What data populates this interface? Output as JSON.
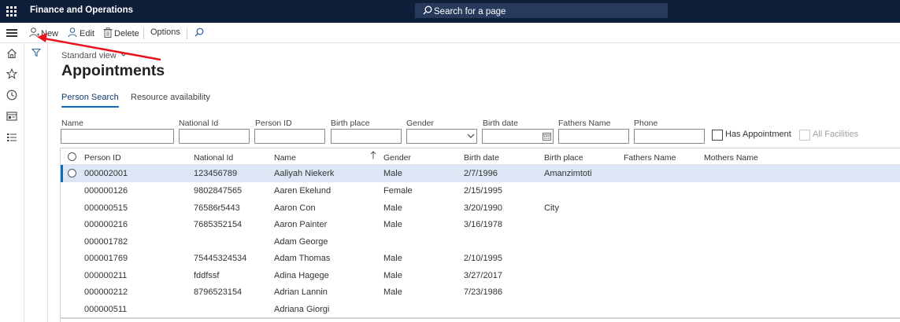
{
  "header": {
    "app_title": "Finance and Operations",
    "search_placeholder": "Search for a page"
  },
  "actions": {
    "new": "New",
    "edit": "Edit",
    "delete": "Delete",
    "options": "Options"
  },
  "page": {
    "view": "Standard view",
    "title": "Appointments"
  },
  "tabs": [
    {
      "label": "Person Search",
      "active": true
    },
    {
      "label": "Resource availability",
      "active": false
    }
  ],
  "filters": {
    "name_label": "Name",
    "national_id_label": "National Id",
    "person_id_label": "Person ID",
    "birth_place_label": "Birth place",
    "gender_label": "Gender",
    "birth_date_label": "Birth date",
    "fathers_name_label": "Fathers Name",
    "phone_label": "Phone",
    "has_appointment_label": "Has Appointment",
    "all_facilities_label": "All Facilities"
  },
  "grid": {
    "columns": [
      "Person ID",
      "National Id",
      "Name",
      "Gender",
      "Birth date",
      "Birth place",
      "Fathers Name",
      "Mothers Name"
    ],
    "rows": [
      {
        "person_id": "000002001",
        "national_id": "123456789",
        "name": "Aaliyah Niekerk",
        "gender": "Male",
        "birth_date": "2/7/1996",
        "birth_place": "Amanzimtoti",
        "selected": true
      },
      {
        "person_id": "000000126",
        "national_id": "9802847565",
        "name": "Aaren Ekelund",
        "gender": "Female",
        "birth_date": "2/15/1995",
        "birth_place": ""
      },
      {
        "person_id": "000000515",
        "national_id": "76586r5443",
        "name": "Aaron Con",
        "gender": "Male",
        "birth_date": "3/20/1990",
        "birth_place": "City"
      },
      {
        "person_id": "000000216",
        "national_id": "7685352154",
        "name": "Aaron Painter",
        "gender": "Male",
        "birth_date": "3/16/1978",
        "birth_place": ""
      },
      {
        "person_id": "000001782",
        "national_id": "",
        "name": "Adam George",
        "gender": "",
        "birth_date": "",
        "birth_place": ""
      },
      {
        "person_id": "000001769",
        "national_id": "75445324534",
        "name": "Adam Thomas",
        "gender": "Male",
        "birth_date": "2/10/1995",
        "birth_place": ""
      },
      {
        "person_id": "000000211",
        "national_id": "fddfssf",
        "name": "Adina Hagege",
        "gender": "Male",
        "birth_date": "3/27/2017",
        "birth_place": ""
      },
      {
        "person_id": "000000212",
        "national_id": "8796523154",
        "name": "Adrian Lannin",
        "gender": "Male",
        "birth_date": "7/23/1986",
        "birth_place": ""
      },
      {
        "person_id": "000000511",
        "national_id": "",
        "name": "Adriana Giorgi",
        "gender": "",
        "birth_date": "",
        "birth_place": ""
      }
    ]
  },
  "colors": {
    "topbar": "#0f1f3a",
    "accent": "#0f6cbd",
    "selected_row": "#dce6f4",
    "annotation": "#e8141d"
  }
}
